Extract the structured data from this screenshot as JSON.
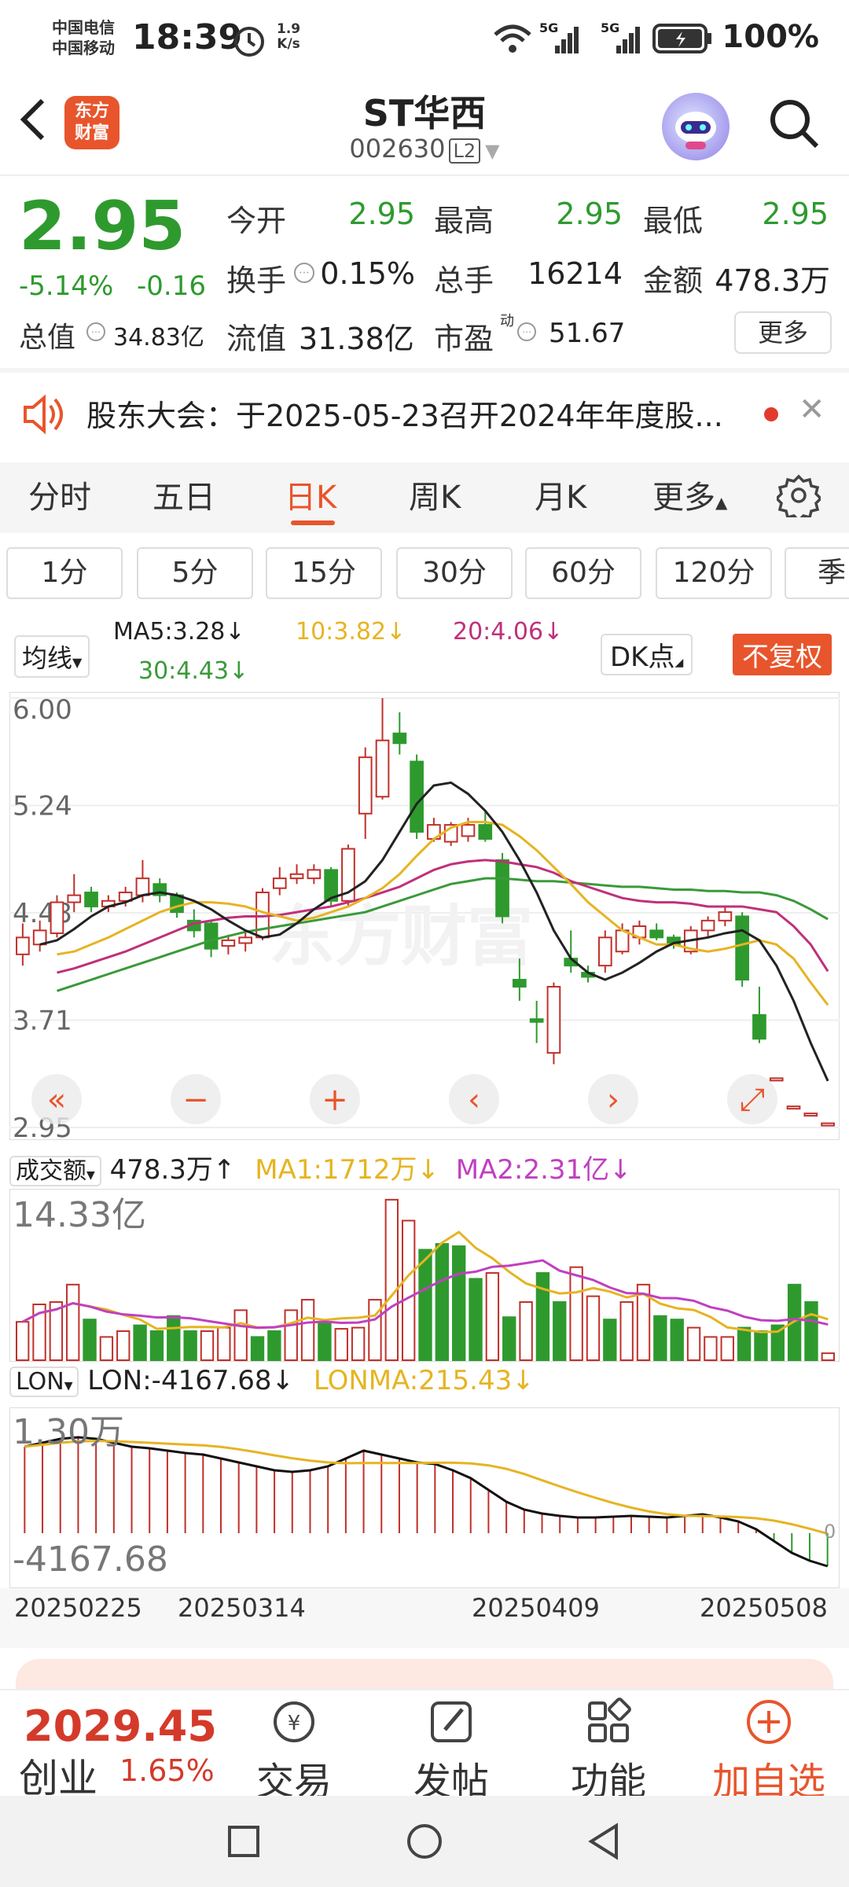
{
  "status": {
    "carrier1": "中国电信",
    "carrier2": "中国移动",
    "time": "18:39",
    "speed_top": "1.9",
    "speed_unit": "K/s",
    "net1": "5G",
    "net2": "5G",
    "battery": "100%"
  },
  "header": {
    "logo_line1": "东方",
    "logo_line2": "财富",
    "name": "ST华西",
    "code": "002630",
    "level": "L2"
  },
  "quote": {
    "price": "2.95",
    "pct": "-5.14%",
    "change": "-0.16",
    "open_label": "今开",
    "open": "2.95",
    "high_label": "最高",
    "high": "2.95",
    "low_label": "最低",
    "low": "2.95",
    "turnover_label": "换手",
    "turnover": "0.15%",
    "volume_label": "总手",
    "volume": "16214",
    "amount_label": "金额",
    "amount": "478.3万",
    "mktcap_label": "总值",
    "mktcap": "34.83亿",
    "float_label": "流值",
    "float": "31.38亿",
    "pe_label": "市盈",
    "pe_sup": "动",
    "pe": "51.67",
    "more": "更多"
  },
  "notice": {
    "text": "股东大会：于2025-05-23召开2024年年度股..."
  },
  "tabs": [
    "分时",
    "五日",
    "日K",
    "周K",
    "月K",
    "更多"
  ],
  "active_tab": "日K",
  "intervals": [
    "1分",
    "5分",
    "15分",
    "30分",
    "60分",
    "120分",
    "季"
  ],
  "ma": {
    "select": "均线",
    "ma5": "MA5:3.28",
    "ma10": "10:3.82",
    "ma20": "20:4.06",
    "ma30": "30:4.43",
    "dk": "DK点",
    "fq": "不复权",
    "colors": {
      "ma5": "#222222",
      "ma10": "#e6b422",
      "ma20": "#c0307a",
      "ma30": "#3a9a3a"
    }
  },
  "kline": {
    "y_labels": [
      "6.00",
      "5.24",
      "4.48",
      "3.71",
      "2.95"
    ],
    "watermark": "东方财富"
  },
  "volume": {
    "select": "成交额",
    "value": "478.3万",
    "ma1": "MA1:1712万",
    "ma2": "MA2:2.31亿",
    "max_label": "14.33亿"
  },
  "lon": {
    "select": "LON",
    "value": "LON:-4167.68",
    "ma": "LONMA:215.43",
    "top_label": "1.30万",
    "bottom_label": "-4167.68",
    "zero_label": "0"
  },
  "dates": [
    "20250225",
    "20250314",
    "20250409",
    "20250508"
  ],
  "bottom": {
    "index_value": "2029.45",
    "index_name": "创业",
    "index_pct": "1.65%",
    "nav": [
      "交易",
      "发帖",
      "功能",
      "加自选"
    ]
  },
  "chart_data": {
    "type": "candlestick",
    "ylim": [
      2.95,
      6.0
    ],
    "candles": [
      {
        "o": 4.18,
        "c": 4.3,
        "h": 4.4,
        "l": 4.1
      },
      {
        "o": 4.25,
        "c": 4.35,
        "h": 4.42,
        "l": 4.2
      },
      {
        "o": 4.33,
        "c": 4.55,
        "h": 4.6,
        "l": 4.3
      },
      {
        "o": 4.55,
        "c": 4.6,
        "h": 4.75,
        "l": 4.48
      },
      {
        "o": 4.62,
        "c": 4.52,
        "h": 4.66,
        "l": 4.48
      },
      {
        "o": 4.52,
        "c": 4.56,
        "h": 4.6,
        "l": 4.48
      },
      {
        "o": 4.56,
        "c": 4.62,
        "h": 4.66,
        "l": 4.52
      },
      {
        "o": 4.6,
        "c": 4.72,
        "h": 4.85,
        "l": 4.55
      },
      {
        "o": 4.68,
        "c": 4.6,
        "h": 4.72,
        "l": 4.55
      },
      {
        "o": 4.6,
        "c": 4.48,
        "h": 4.62,
        "l": 4.44
      },
      {
        "o": 4.42,
        "c": 4.35,
        "h": 4.5,
        "l": 4.3
      },
      {
        "o": 4.4,
        "c": 4.22,
        "h": 4.42,
        "l": 4.16
      },
      {
        "o": 4.24,
        "c": 4.28,
        "h": 4.32,
        "l": 4.18
      },
      {
        "o": 4.26,
        "c": 4.3,
        "h": 4.34,
        "l": 4.2
      },
      {
        "o": 4.3,
        "c": 4.62,
        "h": 4.65,
        "l": 4.28
      },
      {
        "o": 4.65,
        "c": 4.72,
        "h": 4.8,
        "l": 4.6
      },
      {
        "o": 4.72,
        "c": 4.75,
        "h": 4.82,
        "l": 4.68
      },
      {
        "o": 4.72,
        "c": 4.78,
        "h": 4.82,
        "l": 4.68
      },
      {
        "o": 4.78,
        "c": 4.56,
        "h": 4.8,
        "l": 4.52
      },
      {
        "o": 4.56,
        "c": 4.93,
        "h": 4.96,
        "l": 4.52
      },
      {
        "o": 5.18,
        "c": 5.58,
        "h": 5.65,
        "l": 5.0
      },
      {
        "o": 5.3,
        "c": 5.7,
        "h": 6.0,
        "l": 5.28
      },
      {
        "o": 5.75,
        "c": 5.68,
        "h": 5.9,
        "l": 5.6
      },
      {
        "o": 5.55,
        "c": 5.05,
        "h": 5.6,
        "l": 5.0
      },
      {
        "o": 5.0,
        "c": 5.1,
        "h": 5.15,
        "l": 4.98
      },
      {
        "o": 4.98,
        "c": 5.1,
        "h": 5.12,
        "l": 4.95
      },
      {
        "o": 5.02,
        "c": 5.1,
        "h": 5.15,
        "l": 4.98
      },
      {
        "o": 5.1,
        "c": 5.0,
        "h": 5.2,
        "l": 4.98
      },
      {
        "o": 4.85,
        "c": 4.45,
        "h": 4.9,
        "l": 4.4
      },
      {
        "o": 4.0,
        "c": 3.95,
        "h": 4.15,
        "l": 3.85
      },
      {
        "o": 3.72,
        "c": 3.7,
        "h": 3.85,
        "l": 3.55
      },
      {
        "o": 3.48,
        "c": 3.95,
        "h": 3.98,
        "l": 3.4
      },
      {
        "o": 4.15,
        "c": 4.1,
        "h": 4.35,
        "l": 4.05
      },
      {
        "o": 4.05,
        "c": 4.02,
        "h": 4.1,
        "l": 3.98
      },
      {
        "o": 4.1,
        "c": 4.3,
        "h": 4.35,
        "l": 4.05
      },
      {
        "o": 4.2,
        "c": 4.35,
        "h": 4.4,
        "l": 4.18
      },
      {
        "o": 4.3,
        "c": 4.38,
        "h": 4.42,
        "l": 4.25
      },
      {
        "o": 4.35,
        "c": 4.3,
        "h": 4.4,
        "l": 4.28
      },
      {
        "o": 4.3,
        "c": 4.25,
        "h": 4.32,
        "l": 4.22
      },
      {
        "o": 4.2,
        "c": 4.35,
        "h": 4.38,
        "l": 4.18
      },
      {
        "o": 4.35,
        "c": 4.42,
        "h": 4.45,
        "l": 4.3
      },
      {
        "o": 4.42,
        "c": 4.48,
        "h": 4.52,
        "l": 4.38
      },
      {
        "o": 4.45,
        "c": 4.0,
        "h": 4.48,
        "l": 3.95
      },
      {
        "o": 3.75,
        "c": 3.58,
        "h": 3.95,
        "l": 3.55
      },
      {
        "o": 3.3,
        "c": 3.3,
        "h": 3.3,
        "l": 3.3
      },
      {
        "o": 3.1,
        "c": 3.1,
        "h": 3.1,
        "l": 3.1
      },
      {
        "o": 3.05,
        "c": 3.05,
        "h": 3.05,
        "l": 3.05
      },
      {
        "o": 2.98,
        "c": 2.98,
        "h": 2.98,
        "l": 2.98
      }
    ],
    "ma5": [
      4.25,
      4.28,
      4.36,
      4.45,
      4.52,
      4.55,
      4.6,
      4.62,
      4.6,
      4.56,
      4.5,
      4.42,
      4.35,
      4.3,
      4.32,
      4.4,
      4.5,
      4.58,
      4.62,
      4.7,
      4.85,
      5.05,
      5.25,
      5.38,
      5.4,
      5.32,
      5.2,
      5.05,
      4.85,
      4.62,
      4.35,
      4.15,
      4.05,
      4.0,
      4.05,
      4.12,
      4.2,
      4.26,
      4.28,
      4.3,
      4.33,
      4.35,
      4.28,
      4.1,
      3.85,
      3.55,
      3.28
    ],
    "ma10": [
      4.18,
      4.2,
      4.25,
      4.3,
      4.36,
      4.42,
      4.48,
      4.52,
      4.55,
      4.55,
      4.54,
      4.52,
      4.48,
      4.45,
      4.42,
      4.44,
      4.48,
      4.52,
      4.58,
      4.65,
      4.75,
      4.88,
      5.0,
      5.08,
      5.12,
      5.12,
      5.1,
      5.02,
      4.92,
      4.8,
      4.68,
      4.55,
      4.45,
      4.35,
      4.3,
      4.25,
      4.25,
      4.22,
      4.2,
      4.22,
      4.25,
      4.28,
      4.25,
      4.15,
      3.98,
      3.82
    ],
    "ma20": [
      4.05,
      4.08,
      4.12,
      4.16,
      4.2,
      4.25,
      4.3,
      4.35,
      4.4,
      4.42,
      4.44,
      4.45,
      4.45,
      4.46,
      4.48,
      4.5,
      4.52,
      4.55,
      4.58,
      4.62,
      4.66,
      4.72,
      4.78,
      4.82,
      4.84,
      4.85,
      4.84,
      4.82,
      4.8,
      4.76,
      4.7,
      4.66,
      4.62,
      4.58,
      4.56,
      4.55,
      4.55,
      4.54,
      4.52,
      4.52,
      4.52,
      4.5,
      4.48,
      4.38,
      4.25,
      4.06
    ],
    "ma30": [
      3.92,
      3.96,
      4.0,
      4.04,
      4.08,
      4.12,
      4.16,
      4.2,
      4.24,
      4.28,
      4.31,
      4.34,
      4.36,
      4.38,
      4.4,
      4.42,
      4.44,
      4.46,
      4.48,
      4.52,
      4.56,
      4.6,
      4.64,
      4.68,
      4.7,
      4.72,
      4.72,
      4.71,
      4.7,
      4.7,
      4.69,
      4.68,
      4.67,
      4.66,
      4.66,
      4.65,
      4.64,
      4.64,
      4.63,
      4.63,
      4.62,
      4.62,
      4.6,
      4.56,
      4.5,
      4.43
    ],
    "volumes": [
      3.3,
      4.8,
      5.0,
      6.5,
      3.5,
      2.0,
      2.5,
      3.0,
      2.5,
      3.8,
      2.5,
      2.5,
      2.8,
      4.3,
      2.0,
      2.5,
      4.3,
      5.2,
      3.3,
      2.7,
      2.8,
      5.2,
      13.8,
      12.0,
      9.5,
      10.0,
      9.8,
      7.0,
      7.5,
      3.7,
      5.0,
      7.5,
      5.0,
      8.0,
      5.5,
      3.5,
      5.0,
      6.5,
      3.8,
      3.5,
      2.8,
      2.0,
      2.0,
      2.8,
      2.5,
      3.0,
      6.5,
      5.0,
      0.6
    ],
    "vol_up": [
      true,
      true,
      true,
      true,
      false,
      true,
      true,
      false,
      false,
      false,
      false,
      true,
      true,
      true,
      false,
      false,
      true,
      true,
      false,
      true,
      true,
      true,
      true,
      true,
      false,
      false,
      false,
      false,
      true,
      false,
      true,
      false,
      false,
      true,
      true,
      false,
      true,
      true,
      false,
      false,
      true,
      true,
      true,
      false,
      false,
      false,
      false,
      false
    ],
    "lon": [
      1.1,
      1.15,
      1.2,
      1.22,
      1.2,
      1.15,
      1.1,
      1.08,
      1.05,
      1.02,
      1.0,
      0.95,
      0.9,
      0.85,
      0.8,
      0.78,
      0.8,
      0.85,
      0.95,
      1.05,
      1.0,
      0.95,
      0.9,
      0.88,
      0.8,
      0.7,
      0.55,
      0.4,
      0.3,
      0.25,
      0.22,
      0.2,
      0.2,
      0.21,
      0.22,
      0.21,
      0.2,
      0.22,
      0.24,
      0.2,
      0.15,
      0.05,
      -0.1,
      -0.25,
      -0.35,
      -0.42
    ]
  }
}
